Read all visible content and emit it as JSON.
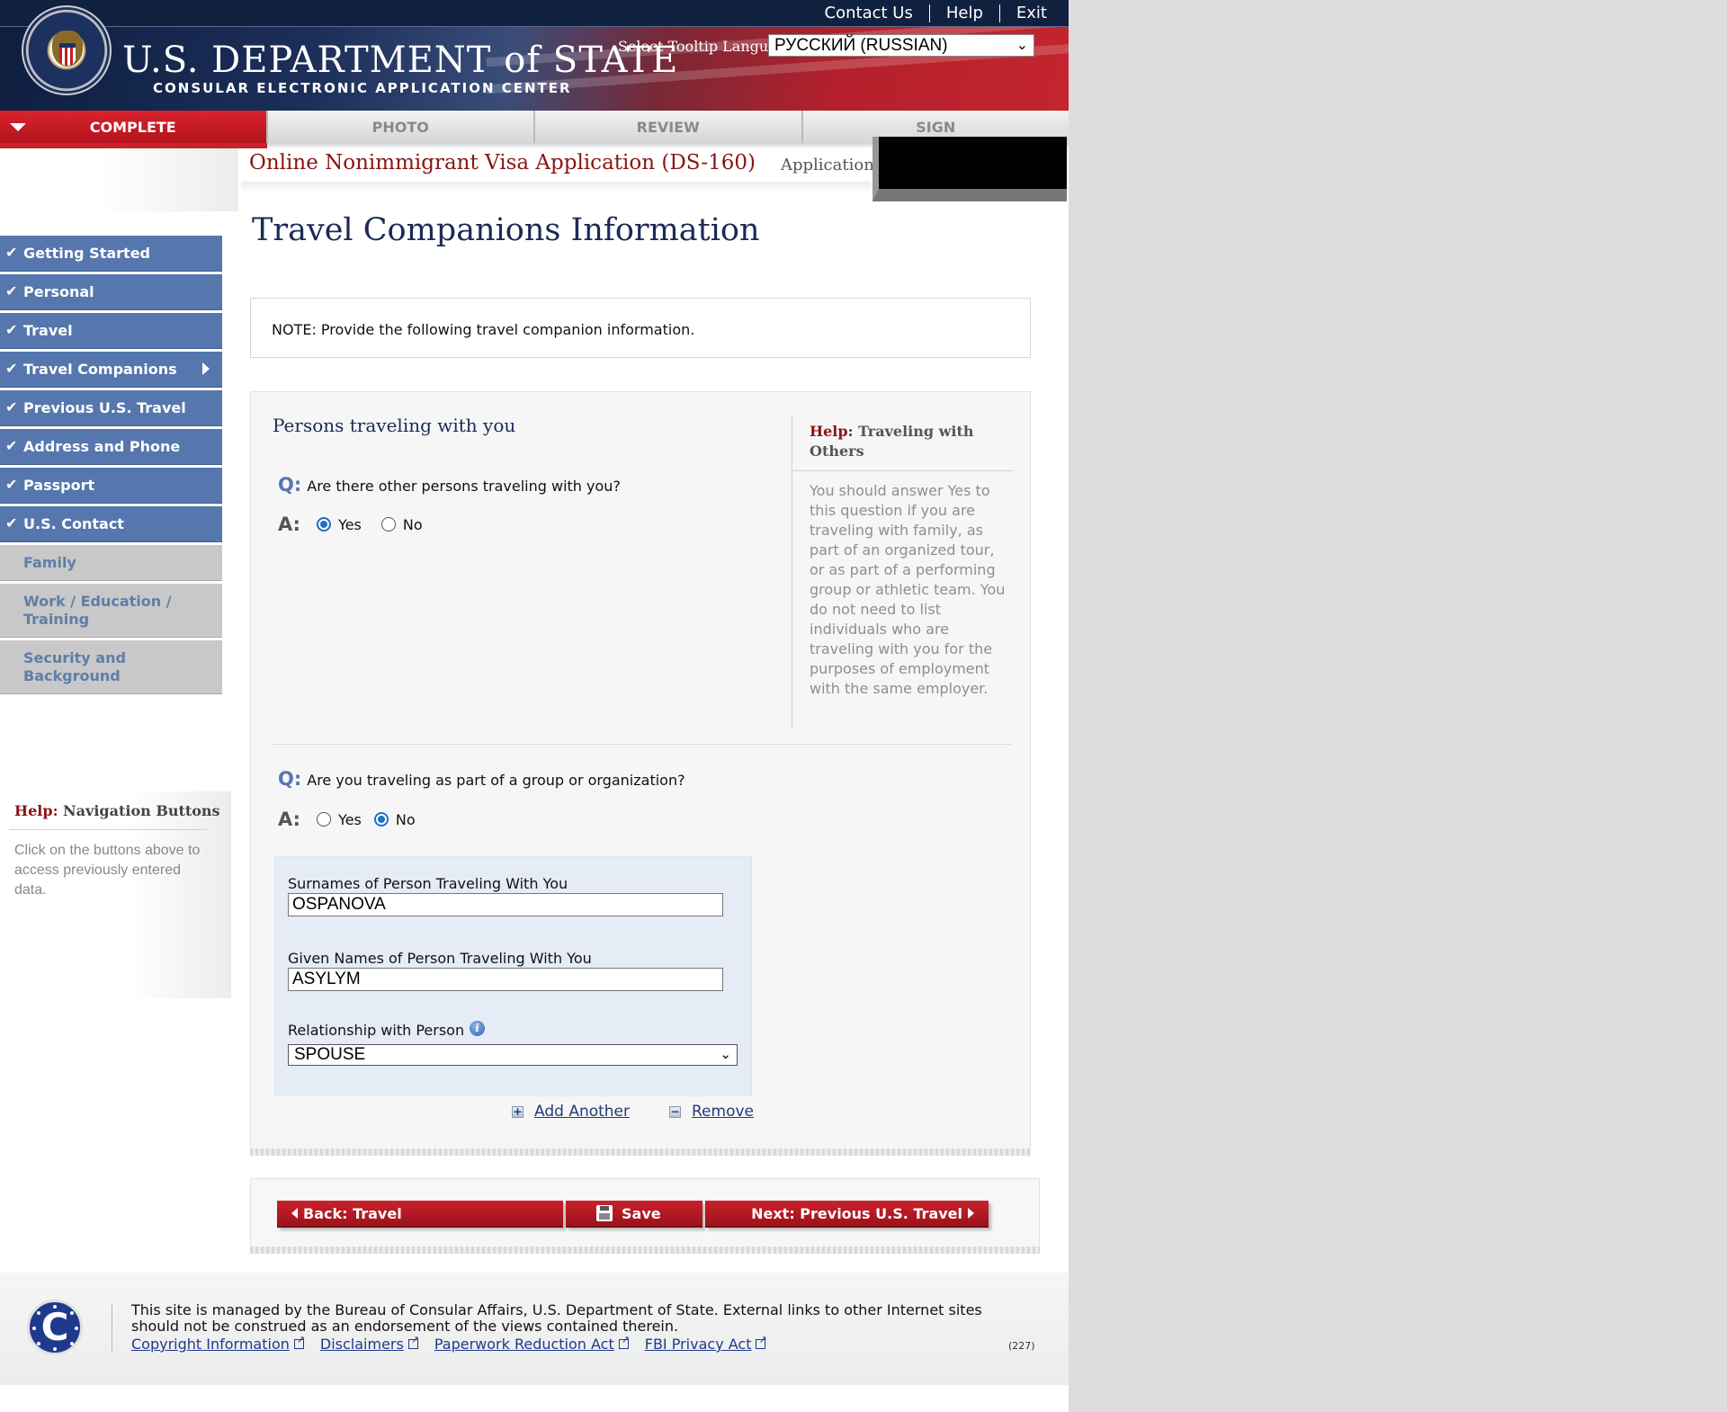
{
  "header": {
    "top_links": [
      "Contact Us",
      "Help",
      "Exit"
    ],
    "dept_title": "U.S. DEPARTMENT of STATE",
    "dept_subtitle": "CONSULAR ELECTRONIC APPLICATION CENTER",
    "tooltip_language_label": "Select Tooltip Language",
    "tooltip_language_value": "РУССКИЙ (RUSSIAN)"
  },
  "steps": [
    {
      "label": "COMPLETE",
      "active": true
    },
    {
      "label": "PHOTO",
      "active": false
    },
    {
      "label": "REVIEW",
      "active": false
    },
    {
      "label": "SIGN",
      "active": false
    }
  ],
  "application": {
    "title": "Online Nonimmigrant Visa Application (DS-160)",
    "id_label": "Application"
  },
  "page_heading": "Travel Companions Information",
  "sidebar": {
    "items": [
      {
        "label": "Getting Started",
        "status": "done"
      },
      {
        "label": "Personal",
        "status": "done"
      },
      {
        "label": "Travel",
        "status": "done"
      },
      {
        "label": "Travel Companions",
        "status": "current"
      },
      {
        "label": "Previous U.S. Travel",
        "status": "done"
      },
      {
        "label": "Address and Phone",
        "status": "done"
      },
      {
        "label": "Passport",
        "status": "done"
      },
      {
        "label": "U.S. Contact",
        "status": "done"
      },
      {
        "label": "Family",
        "status": "todo"
      },
      {
        "label": "Work / Education / Training",
        "status": "todo"
      },
      {
        "label": "Security and Background",
        "status": "todo"
      }
    ],
    "help_title_prefix": "Help:",
    "help_title": "Navigation Buttons",
    "help_body": "Click on the buttons above to access previously entered data."
  },
  "note": "NOTE: Provide the following travel companion information.",
  "form": {
    "section_title": "Persons traveling with you",
    "q_marker": "Q:",
    "a_marker": "A:",
    "q1": "Are there other persons traveling with you?",
    "q1_yes": "Yes",
    "q1_no": "No",
    "q1_answer": "Yes",
    "q2": "Are you traveling as part of a group or organization?",
    "q2_yes": "Yes",
    "q2_no": "No",
    "q2_answer": "No",
    "help_prefix": "Help:",
    "help_title": "Traveling with Others",
    "help_body": "You should answer Yes to this question if you are traveling with family, as part of an organized tour, or as part of a performing group or athletic team. You do not need to list individuals who are traveling with you for the purposes of employment with the same employer.",
    "companion": {
      "surname_label": "Surnames of Person Traveling With You",
      "surname_value": "OSPANOVA",
      "given_label": "Given Names of Person Traveling With You",
      "given_value": "ASYLYM",
      "relationship_label": "Relationship with Person",
      "relationship_value": "SPOUSE"
    },
    "add_another": "Add Another",
    "remove": "Remove"
  },
  "buttons": {
    "back": "Back: Travel",
    "save": "Save",
    "next": "Next: Previous U.S. Travel"
  },
  "footer": {
    "text": "This site is managed by the Bureau of Consular Affairs, U.S. Department of State. External links to other Internet sites should not be construed as an endorsement of the views contained therein.",
    "links": [
      "Copyright Information",
      "Disclaimers",
      "Paperwork Reduction Act",
      "FBI Privacy Act"
    ],
    "code": "(227)",
    "seal_letter": "C"
  },
  "colors": {
    "brand_red": "#c4252f",
    "nav_blue": "#5577ad",
    "heading_navy": "#1b2a55",
    "title_red": "#8b1414"
  }
}
